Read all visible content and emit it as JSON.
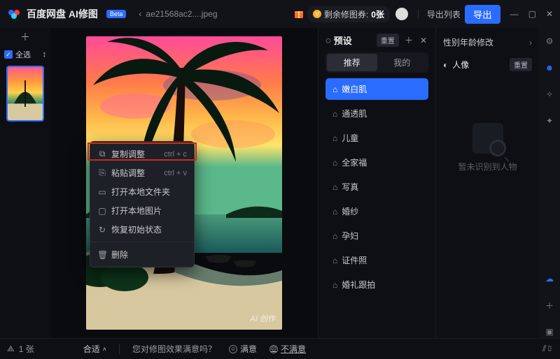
{
  "titlebar": {
    "app_name": "百度网盘 AI修图",
    "beta": "Beta",
    "filename": "ae21568ac2....jpeg",
    "coupon_label": "剩余修图券:",
    "coupon_count": "0张",
    "export_list": "导出列表",
    "export": "导出"
  },
  "thumbs": {
    "select_all": "全选",
    "reorder": "↕"
  },
  "context_menu": {
    "items": [
      {
        "icon": "⧉",
        "label": "复制调整",
        "shortcut": "ctrl + c"
      },
      {
        "icon": "⎘",
        "label": "粘贴调整",
        "shortcut": "ctrl + v"
      },
      {
        "icon": "▭",
        "label": "打开本地文件夹",
        "shortcut": ""
      },
      {
        "icon": "▢",
        "label": "打开本地图片",
        "shortcut": ""
      },
      {
        "icon": "↻",
        "label": "恢复初始状态",
        "shortcut": ""
      },
      {
        "icon": "🗑",
        "label": "删除",
        "shortcut": ""
      }
    ]
  },
  "preset": {
    "title": "预设",
    "reset": "重置",
    "tabs": {
      "rec": "推荐",
      "mine": "我的"
    },
    "tags": [
      "嫩白肌",
      "通透肌",
      "儿童",
      "全家福",
      "写真",
      "婚纱",
      "孕妇",
      "证件照",
      "婚礼跟拍"
    ]
  },
  "props": {
    "gender_age": "性别年龄修改",
    "portrait": "人像",
    "reset": "重置",
    "placeholder": "暂未识别到人物"
  },
  "bottom": {
    "count": "1 张",
    "fit": "合适",
    "question": "您对修图效果满意吗？",
    "yes": "满意",
    "no": "不满意"
  },
  "canvas": {
    "watermark": "AI 创作"
  }
}
